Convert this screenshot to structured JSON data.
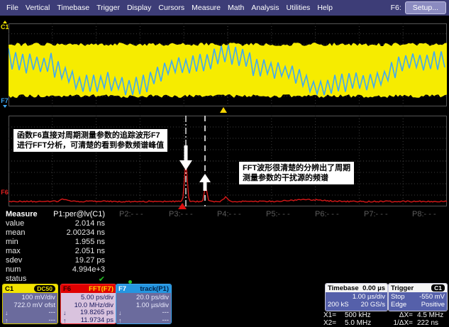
{
  "menu": {
    "items": [
      "File",
      "Vertical",
      "Timebase",
      "Trigger",
      "Display",
      "Cursors",
      "Measure",
      "Math",
      "Analysis",
      "Utilities",
      "Help"
    ],
    "f_label": "F6:",
    "setup_label": "Setup..."
  },
  "traces": {
    "c1_label": "C1",
    "f7_label": "F7",
    "f6_label": "F6",
    "c1_color": "#f6ec00",
    "f7_color": "#3fa9f5",
    "f6_color": "#d81818"
  },
  "annotations": {
    "note1_line1": "函数F6直接对周期测量参数的追踪波形F7",
    "note1_line2": "进行FFT分析，可清楚的看到参数频谱峰值",
    "note2_line1": "FFT波形很清楚的分辨出了周期",
    "note2_line2": "测量参数的干扰源的频谱"
  },
  "measure": {
    "title": "Measure",
    "p1_header": "P1:per@lv(C1)",
    "other_headers": [
      "P2:- - -",
      "P3:- - -",
      "P4:- - -",
      "P5:- - -",
      "P6:- - -",
      "P7:- - -",
      "P8:- - -"
    ],
    "rows": [
      {
        "label": "value",
        "value": "2.014 ns"
      },
      {
        "label": "mean",
        "value": "2.00234 ns"
      },
      {
        "label": "min",
        "value": "1.955 ns"
      },
      {
        "label": "max",
        "value": "2.051 ns"
      },
      {
        "label": "sdev",
        "value": "19.27 ps"
      },
      {
        "label": "num",
        "value": "4.994e+3"
      }
    ],
    "status_label": "status",
    "status_check": "✔"
  },
  "descriptors": {
    "c1": {
      "id": "C1",
      "badge": "DC50",
      "line1": "100 mV/div",
      "line2": "722.0 mV ofst",
      "cur1": "---",
      "cur2": "---"
    },
    "f6": {
      "id": "F6",
      "label": "FFT(F7)",
      "line1": "5.00 ps/div",
      "line2": "10.0 MHz/div",
      "cur1": "19.8265 ps",
      "cur2": "11.9734 ps"
    },
    "f7": {
      "id": "F7",
      "label": "track(P1)",
      "line1": "20.0 ps/div",
      "line2": "1.00 µs/div",
      "cur1": "---",
      "cur2": "---"
    }
  },
  "timebase": {
    "title": "Timebase",
    "offset": "0.00 µs",
    "scale": "1.00 µs/div",
    "samples": "200 kS",
    "rate": "20 GS/s"
  },
  "trigger": {
    "title": "Trigger",
    "source": "C1",
    "mode": "Stop",
    "level": "-550 mV",
    "type": "Edge",
    "slope": "Positive"
  },
  "cursors": {
    "x1_label": "X1=",
    "x1_value": "500 kHz",
    "dx_label": "ΔX=",
    "dx_value": "4.5 MHz",
    "x2_label": "X2=",
    "x2_value": "5.0 MHz",
    "invdx_label": "1/ΔX=",
    "invdx_value": "222 ns"
  }
}
